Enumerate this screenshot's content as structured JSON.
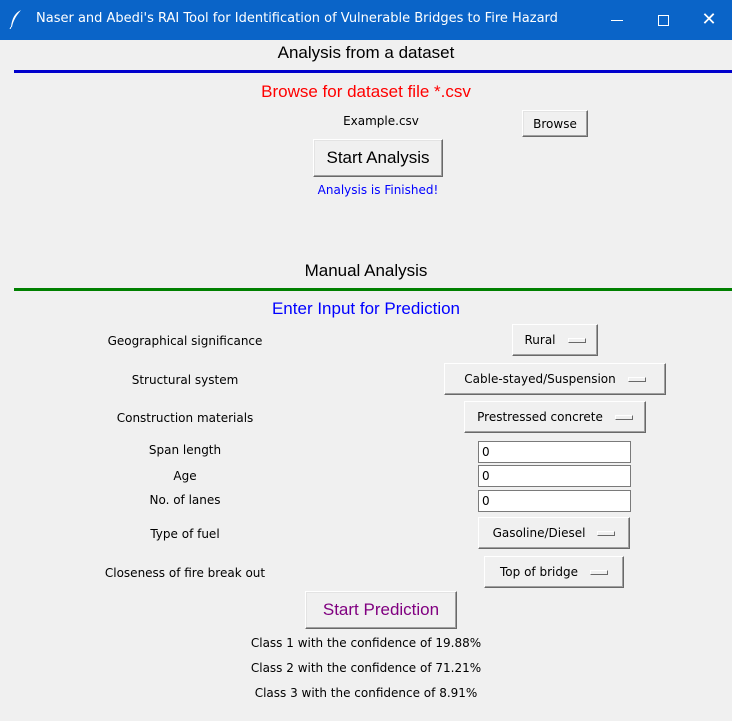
{
  "window": {
    "title": "Naser and Abedi's RAI Tool for Identification of Vulnerable Bridges to Fire Hazard",
    "icon": "feather-icon",
    "controls": {
      "minimize": "minimize-icon",
      "maximize": "maximize-icon",
      "close": "close-icon"
    }
  },
  "dataset_section": {
    "heading": "Analysis from a dataset",
    "rule_color": "#0000cc",
    "browse_prompt": "Browse for dataset file *.csv",
    "browse_prompt_color": "#ff0000",
    "filename": "Example.csv",
    "browse_label": "Browse",
    "start_label": "Start Analysis",
    "status": "Analysis is Finished!",
    "status_color": "#0000ff"
  },
  "manual_section": {
    "heading": "Manual Analysis",
    "rule_color": "#008000",
    "prompt": "Enter Input for Prediction",
    "prompt_color": "#0000ff",
    "fields": {
      "geo": {
        "label": "Geographical significance",
        "value": "Rural"
      },
      "structure": {
        "label": "Structural system",
        "value": "Cable-stayed/Suspension"
      },
      "material": {
        "label": "Construction materials",
        "value": "Prestressed concrete"
      },
      "span": {
        "label": "Span length",
        "value": "0"
      },
      "age": {
        "label": "Age",
        "value": "0"
      },
      "lanes": {
        "label": "No. of lanes",
        "value": "0"
      },
      "fuel": {
        "label": "Type of fuel",
        "value": "Gasoline/Diesel"
      },
      "closeness": {
        "label": "Closeness of fire break out",
        "value": "Top of bridge"
      }
    },
    "predict_label": "Start Prediction",
    "predict_color": "#800080",
    "results": [
      "Class 1 with the confidence of 19.88%",
      "Class 2 with the confidence of 71.21%",
      "Class 3 with the confidence of 8.91%"
    ]
  }
}
